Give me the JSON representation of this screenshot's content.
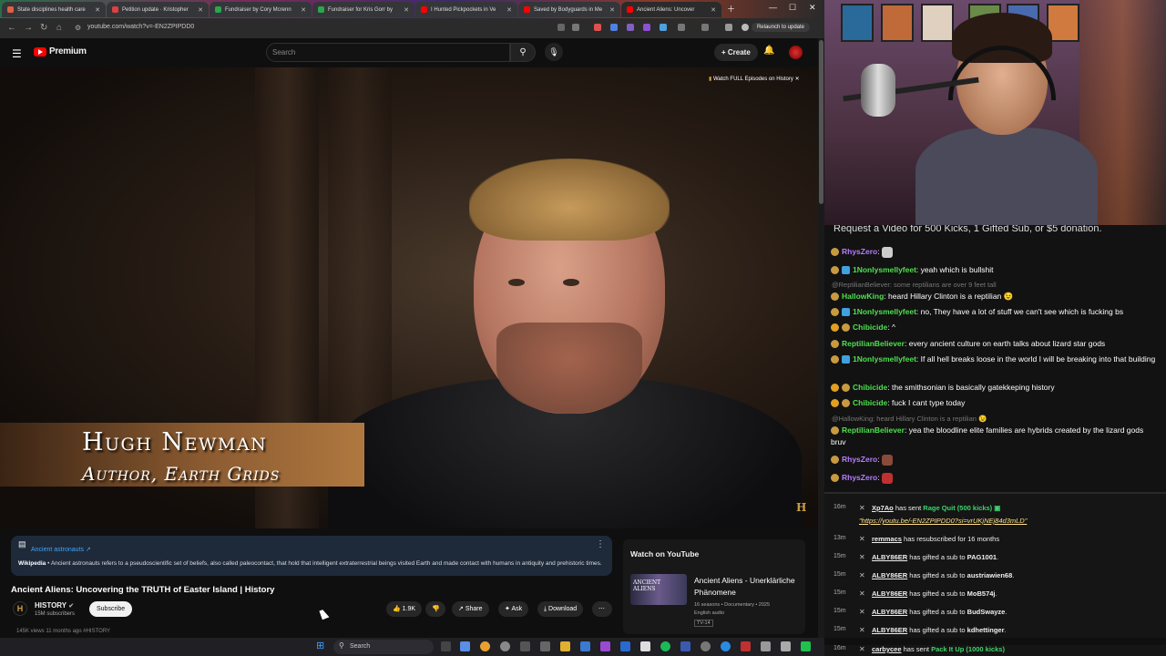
{
  "browser": {
    "tabs": [
      {
        "label": "State disciplines health care",
        "color": "#e06040"
      },
      {
        "label": "Petition update · Kristopher",
        "color": "#e04040"
      },
      {
        "label": "Fundraiser by Cory Mcrenn",
        "color": "#2ea44f"
      },
      {
        "label": "Fundraiser for Kris Gorr by",
        "color": "#2ea44f"
      },
      {
        "label": "I Hunted Pickpockets in Ve",
        "color": "#ff0000"
      },
      {
        "label": "Saved by Bodyguards in Me",
        "color": "#ff0000"
      },
      {
        "label": "Ancient Aliens: Uncover",
        "color": "#ff0000"
      }
    ],
    "url": "youtube.com/watch?v=-EN2ZPIPDD0",
    "relaunch": "Relaunch to update"
  },
  "youtube": {
    "logo_text": "Premium",
    "search_placeholder": "Search",
    "create_label": "+ Create",
    "watch_full": "Watch FULL Episodes on History",
    "lower_third_name": "Hugh Newman",
    "lower_third_title": "Author, Earth Grids",
    "info": {
      "link": "Ancient astronauts ↗",
      "source": "Wikipedia",
      "text": " • Ancient astronauts refers to a pseudoscientific set of beliefs, also called paleocontact, that hold that intelligent extraterrestrial beings visited Earth and made contact with humans in antiquity and prehistoric times."
    },
    "video_title": "Ancient Aliens: Uncovering the TRUTH of Easter Island | History",
    "channel": {
      "name": "HISTORY",
      "subs": "15M subscribers",
      "logo": "H"
    },
    "subscribe": "Subscribe",
    "actions": {
      "likes": "1.9K",
      "share": "Share",
      "ask": "Ask",
      "download": "Download"
    },
    "views": "145K views  11 months ago  #HISTORY",
    "watch_on_youtube": {
      "header": "Watch on YouTube",
      "thumb_text": "ANCIENT ALIENS",
      "title": "Ancient Aliens - Unerklärliche Phänomene",
      "meta1": "16 seasons • Documentary • 2025",
      "meta2": "English audio",
      "rating": "TV-14"
    }
  },
  "chat": {
    "banner": "Request a Video for 500 Kicks, 1 Gifted Sub, or $5 donation.",
    "messages": [
      {
        "user": "RhysZero",
        "user_color": "#b57cff",
        "text": ""
      },
      {
        "user": "1Nonlysmellyfeet",
        "user_color": "#4ee04e",
        "text": " yeah which is bullshit"
      },
      {
        "reply": "@ReptilianBeliever: some reptilians are over 9 feet tall"
      },
      {
        "user": "HallowKing",
        "user_color": "#4ee04e",
        "text": " heard Hillary Clinton is a reptilian 😉"
      },
      {
        "user": "1Nonlysmellyfeet",
        "user_color": "#4ee04e",
        "text": " no, They have a lot of stuff we can't see which is fucking bs"
      },
      {
        "user": "Chibicide",
        "user_color": "#4ee04e",
        "text": " ^"
      },
      {
        "user": "ReptilianBeliever",
        "user_color": "#4ee04e",
        "text": " every ancient culture on earth talks about lizard star gods"
      },
      {
        "user": "1Nonlysmellyfeet",
        "user_color": "#4ee04e",
        "text": " If all hell breaks loose in the world I will be breaking into that building"
      },
      {
        "user": "Chibicide",
        "user_color": "#4ee04e",
        "text": " the smithsonian is basically gatekkeping history"
      },
      {
        "user": "Chibicide",
        "user_color": "#4ee04e",
        "text": " fuck I cant type today"
      },
      {
        "reply": "@HallowKing: heard Hillary Clinton is a reptilian 😉"
      },
      {
        "user": "ReptilianBeliever",
        "user_color": "#4ee04e",
        "text": " yea the bloodline elite families are hybrids created by the lizard gods bruv"
      },
      {
        "user": "RhysZero",
        "user_color": "#b57cff",
        "text": ""
      },
      {
        "user": "RhysZero",
        "user_color": "#b57cff",
        "text": ""
      }
    ]
  },
  "feed": [
    {
      "time": "16m",
      "name": "Xp7Ao",
      "mid": " has sent ",
      "green": "Rage Quit (500 kicks)",
      "end": ""
    },
    {
      "time": "",
      "link": "\"https://youtu.be/-EN2ZPIPDD0?si=vrUKjNEj84d3mLD\""
    },
    {
      "time": "13m",
      "name": "remmacs",
      "mid": " has resubscribed for 16 months",
      "green": "",
      "end": ""
    },
    {
      "time": "15m",
      "name": "ALBY86ER",
      "mid": " has gifted a sub to ",
      "bold2": "PAG1001",
      "end": "."
    },
    {
      "time": "15m",
      "name": "ALBY86ER",
      "mid": " has gifted a sub to ",
      "bold2": "austriawien68",
      "end": "."
    },
    {
      "time": "15m",
      "name": "ALBY86ER",
      "mid": " has gifted a sub to ",
      "bold2": "MoB574j",
      "end": "."
    },
    {
      "time": "15m",
      "name": "ALBY86ER",
      "mid": " has gifted a sub to ",
      "bold2": "BudSwayze",
      "end": "."
    },
    {
      "time": "15m",
      "name": "ALBY86ER",
      "mid": " has gifted a sub to ",
      "bold2": "kdhettinger",
      "end": "."
    },
    {
      "time": "16m",
      "name": "carbycee",
      "mid": " has sent ",
      "green": "Pack It Up (1000 kicks)",
      "end": ""
    }
  ],
  "taskbar": {
    "search": "Search"
  }
}
